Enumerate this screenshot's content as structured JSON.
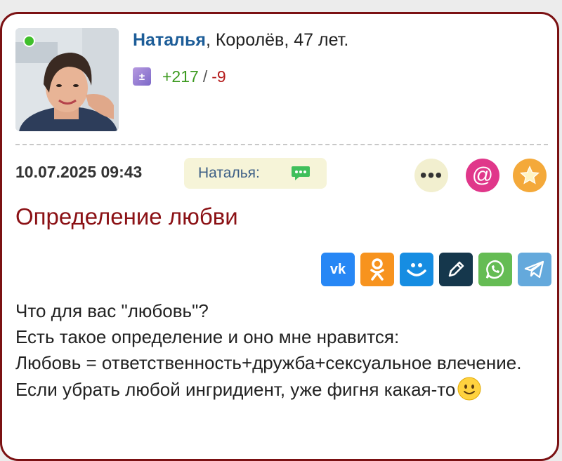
{
  "profile": {
    "name": "Наталья",
    "location_age": ", Королёв, 47 лет.",
    "rating_plus": "+217",
    "rating_separator": "/",
    "rating_minus": "-9",
    "online_color": "#3fbf2b"
  },
  "post": {
    "datetime": "10.07.2025 09:43",
    "author_chip": "Наталья:",
    "title": "Определение любви",
    "paragraphs": [
      "Что для вас \"любовь\"?",
      "Есть такое определение и оно мне нравится:",
      "Любовь = ответственность+дружба+сексуальное влечение. Если убрать любой ингридиент, уже фигня какая-то"
    ]
  },
  "actions": {
    "more_label": "•••",
    "mention_label": "@"
  },
  "share": [
    {
      "name": "vk",
      "label": "VK",
      "color": "#2787f5"
    },
    {
      "name": "odnoklassniki",
      "label": "OK",
      "color": "#f7931e"
    },
    {
      "name": "moimir",
      "label": "MM",
      "color": "#168de2"
    },
    {
      "name": "livejournal",
      "label": "LJ",
      "color": "#15374c"
    },
    {
      "name": "whatsapp",
      "label": "WA",
      "color": "#65bc54"
    },
    {
      "name": "telegram",
      "label": "TG",
      "color": "#64a9dc"
    }
  ],
  "colors": {
    "card_border": "#7b1113",
    "title": "#8b1115",
    "name_link": "#1d5d98"
  }
}
